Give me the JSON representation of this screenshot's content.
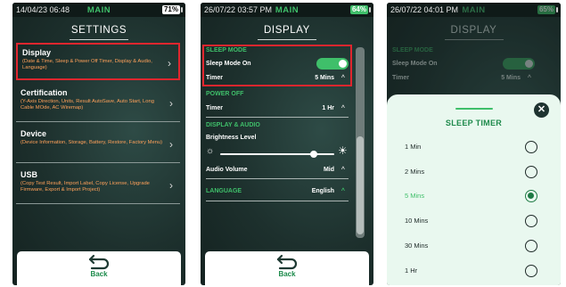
{
  "screens": [
    {
      "status": {
        "time": "14/04/23 06:48",
        "mode": "MAIN",
        "battery": "71%"
      },
      "title": "SETTINGS",
      "items": [
        {
          "name": "Display",
          "desc": "(Date & Time, Sleep & Power Off Timer, Display & Audio, Language)"
        },
        {
          "name": "Certification",
          "desc": "(Y-Axis Direction, Units, Result AutoSave, Auto Start, Long Cable MOde, AC Wiremap)"
        },
        {
          "name": "Device",
          "desc": "(Device Information, Storage, Battery, Restore, Factory Menu)"
        },
        {
          "name": "USB",
          "desc": "(Copy Test Result, Import Label, Copy License, Upgrade Firmware, Export & Import Project)"
        }
      ],
      "back": "Back"
    },
    {
      "status": {
        "time": "26/07/22 03:57 PM",
        "mode": "MAIN",
        "battery": "64%"
      },
      "title": "DISPLAY",
      "sleep_mode": {
        "section": "SLEEP MODE",
        "label": "Sleep Mode On",
        "on": true,
        "timer_label": "Timer",
        "timer_value": "5 Mins"
      },
      "power_off": {
        "section": "POWER OFF",
        "timer_label": "Timer",
        "timer_value": "1 Hr"
      },
      "display_audio": {
        "section": "DISPLAY & AUDIO",
        "brightness_label": "Brightness Level",
        "brightness_level": 0.82,
        "volume_label": "Audio Volume",
        "volume_value": "Mid"
      },
      "language": {
        "section": "LANGUAGE",
        "value": "English"
      },
      "back": "Back"
    },
    {
      "status": {
        "time": "26/07/22 04:01 PM",
        "mode": "MAIN",
        "battery": "65%"
      },
      "title": "DISPLAY",
      "bg_sleep_mode": {
        "section": "SLEEP MODE",
        "label": "Sleep Mode On",
        "timer_label": "Timer",
        "timer_value": "5 Mins"
      },
      "sheet": {
        "title": "SLEEP TIMER",
        "options": [
          "1 Min",
          "2 Mins",
          "5 Mins",
          "10 Mins",
          "30 Mins",
          "1 Hr"
        ],
        "selected_index": 2
      }
    }
  ],
  "colors": {
    "accent_green": "#3fbf6a",
    "highlight_red": "#e0262e",
    "desc_orange": "#ffa15a"
  },
  "icons": {
    "back": "return-arrow-icon",
    "chevron": "chevron-right-icon",
    "caret": "caret-up-icon",
    "close": "close-icon",
    "sun": "sun-icon"
  }
}
